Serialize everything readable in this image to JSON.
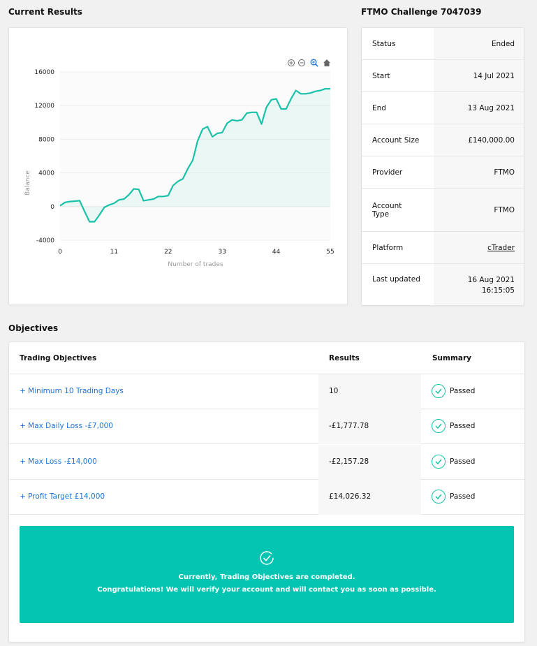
{
  "headings": {
    "current_results": "Current Results",
    "account_title": "FTMO Challenge 7047039",
    "objectives": "Objectives"
  },
  "chart_toolbar": [
    "zoom-in-icon",
    "zoom-out-icon",
    "magnifier-icon",
    "home-icon"
  ],
  "chart_data": {
    "type": "area",
    "title": "",
    "xlabel": "Number of trades",
    "ylabel": "Balance",
    "xlim": [
      0,
      55
    ],
    "ylim": [
      -4000,
      16000
    ],
    "x_ticks": [
      "0",
      "11",
      "22",
      "33",
      "44",
      "55"
    ],
    "y_ticks": [
      "16000",
      "12000",
      "8000",
      "4000",
      "0",
      "-4000"
    ],
    "color": "#19c2a8",
    "series": [
      {
        "x": [
          0,
          1,
          2,
          3,
          4,
          5,
          6,
          7,
          8,
          9,
          10,
          11,
          12,
          13,
          14,
          15,
          16,
          17,
          18,
          19,
          20,
          21,
          22,
          23,
          24,
          25,
          26,
          27,
          28,
          29,
          30,
          31,
          32,
          33,
          34,
          35,
          36,
          37,
          38,
          39,
          40,
          41,
          42,
          43,
          44,
          45,
          46,
          47,
          48,
          49,
          50,
          51,
          52,
          53,
          54,
          55
        ],
        "y": [
          100,
          500,
          600,
          650,
          700,
          -600,
          -1800,
          -1800,
          -1000,
          -100,
          200,
          400,
          800,
          900,
          1400,
          2100,
          2050,
          700,
          800,
          900,
          1200,
          1200,
          1300,
          2500,
          3000,
          3300,
          4500,
          5500,
          7800,
          9200,
          9500,
          8300,
          8700,
          8800,
          9900,
          10300,
          10200,
          10300,
          11100,
          11200,
          11200,
          9800,
          11800,
          12700,
          12800,
          11600,
          11600,
          12800,
          13800,
          13400,
          13400,
          13500,
          13700,
          13800,
          14000,
          14000
        ]
      }
    ]
  },
  "account_info": [
    {
      "key": "Status",
      "value": "Ended"
    },
    {
      "key": "Start",
      "value": "14 Jul 2021"
    },
    {
      "key": "End",
      "value": "13 Aug 2021"
    },
    {
      "key": "Account Size",
      "value": "£140,000.00"
    },
    {
      "key": "Provider",
      "value": "FTMO"
    },
    {
      "key": "Account Type",
      "value": "FTMO"
    },
    {
      "key": "Platform",
      "value": "cTrader"
    },
    {
      "key": "Last updated",
      "value": "16 Aug 2021 16:15:05"
    }
  ],
  "objectives_table": {
    "headers": [
      "Trading Objectives",
      "Results",
      "Summary"
    ],
    "rows": [
      {
        "objective": "+ Minimum 10 Trading Days",
        "result": "10",
        "summary": "Passed"
      },
      {
        "objective": "+ Max Daily Loss -£7,000",
        "result": "-£1,777.78",
        "summary": "Passed"
      },
      {
        "objective": "+ Max Loss -£14,000",
        "result": "-£2,157.28",
        "summary": "Passed"
      },
      {
        "objective": "+ Profit Target £14,000",
        "result": "£14,026.32",
        "summary": "Passed"
      }
    ]
  },
  "banner": {
    "line1": "Currently, Trading Objectives are completed.",
    "line2": "Congratulations! We will verify your account and will contact you as soon as possible."
  }
}
